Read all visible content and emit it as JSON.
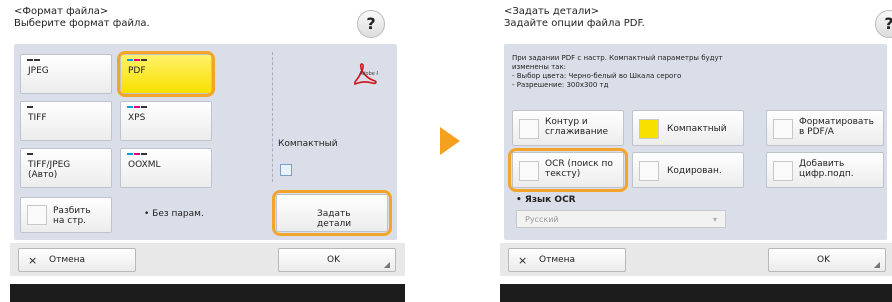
{
  "left": {
    "title_line1": "<Формат файла>",
    "title_line2": "Выберите формат файла.",
    "help_label": "?",
    "formats": [
      {
        "label": "JPEG"
      },
      {
        "label": "PDF"
      },
      {
        "label": "TIFF"
      },
      {
        "label": "XPS"
      },
      {
        "label": "TIFF/JPEG (Авто)"
      },
      {
        "label": "OOXML"
      }
    ],
    "split_label": "Разбить на стр.",
    "no_params_label": "• Без парам.",
    "compact_label": "Компактный",
    "details_label": "Задать детали",
    "cancel_label": "Отмена",
    "ok_label": "OK"
  },
  "right": {
    "title_line1": "<Задать детали>",
    "title_line2": "Задайте опции файла PDF.",
    "help_label": "?",
    "info_lines": [
      "При задании PDF с настр. Компактный параметры будут",
      "изменены так:",
      "- Выбор цвета: Черно-белый во Шкала серого",
      "- Разрешение: 300x300 тд"
    ],
    "options": [
      {
        "label": "Контур и сглаживание"
      },
      {
        "label": "Компактный"
      },
      {
        "label": "Форматировать в PDF/A"
      },
      {
        "label": "OCR (поиск по тексту)"
      },
      {
        "label": "Кодирован."
      },
      {
        "label": "Добавить цифр.подп."
      }
    ],
    "ocr_lang_label": "• Язык OCR",
    "ocr_lang_value": "Русский",
    "cancel_label": "Отмена",
    "ok_label": "OK"
  },
  "colors": {
    "highlight": "#f2a52a",
    "selected": "#f8e100",
    "arrow": "#f4a11f"
  }
}
